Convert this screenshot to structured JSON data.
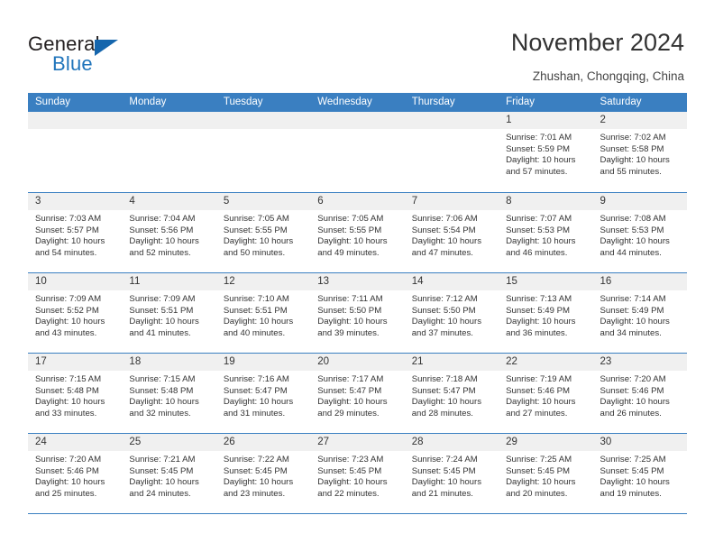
{
  "brand": {
    "name_part1": "General",
    "name_part2": "Blue",
    "accent_color": "#1f74bb"
  },
  "header": {
    "title": "November 2024",
    "subtitle": "Zhushan, Chongqing, China"
  },
  "calendar": {
    "header_bg": "#3a7fc1",
    "weekdays": [
      "Sunday",
      "Monday",
      "Tuesday",
      "Wednesday",
      "Thursday",
      "Friday",
      "Saturday"
    ],
    "weeks": [
      [
        {
          "day": "",
          "sunrise": "",
          "sunset": "",
          "daylight": "",
          "empty": true
        },
        {
          "day": "",
          "sunrise": "",
          "sunset": "",
          "daylight": "",
          "empty": true
        },
        {
          "day": "",
          "sunrise": "",
          "sunset": "",
          "daylight": "",
          "empty": true
        },
        {
          "day": "",
          "sunrise": "",
          "sunset": "",
          "daylight": "",
          "empty": true
        },
        {
          "day": "",
          "sunrise": "",
          "sunset": "",
          "daylight": "",
          "empty": true
        },
        {
          "day": "1",
          "sunrise": "Sunrise: 7:01 AM",
          "sunset": "Sunset: 5:59 PM",
          "daylight": "Daylight: 10 hours and 57 minutes.",
          "empty": false
        },
        {
          "day": "2",
          "sunrise": "Sunrise: 7:02 AM",
          "sunset": "Sunset: 5:58 PM",
          "daylight": "Daylight: 10 hours and 55 minutes.",
          "empty": false
        }
      ],
      [
        {
          "day": "3",
          "sunrise": "Sunrise: 7:03 AM",
          "sunset": "Sunset: 5:57 PM",
          "daylight": "Daylight: 10 hours and 54 minutes.",
          "empty": false
        },
        {
          "day": "4",
          "sunrise": "Sunrise: 7:04 AM",
          "sunset": "Sunset: 5:56 PM",
          "daylight": "Daylight: 10 hours and 52 minutes.",
          "empty": false
        },
        {
          "day": "5",
          "sunrise": "Sunrise: 7:05 AM",
          "sunset": "Sunset: 5:55 PM",
          "daylight": "Daylight: 10 hours and 50 minutes.",
          "empty": false
        },
        {
          "day": "6",
          "sunrise": "Sunrise: 7:05 AM",
          "sunset": "Sunset: 5:55 PM",
          "daylight": "Daylight: 10 hours and 49 minutes.",
          "empty": false
        },
        {
          "day": "7",
          "sunrise": "Sunrise: 7:06 AM",
          "sunset": "Sunset: 5:54 PM",
          "daylight": "Daylight: 10 hours and 47 minutes.",
          "empty": false
        },
        {
          "day": "8",
          "sunrise": "Sunrise: 7:07 AM",
          "sunset": "Sunset: 5:53 PM",
          "daylight": "Daylight: 10 hours and 46 minutes.",
          "empty": false
        },
        {
          "day": "9",
          "sunrise": "Sunrise: 7:08 AM",
          "sunset": "Sunset: 5:53 PM",
          "daylight": "Daylight: 10 hours and 44 minutes.",
          "empty": false
        }
      ],
      [
        {
          "day": "10",
          "sunrise": "Sunrise: 7:09 AM",
          "sunset": "Sunset: 5:52 PM",
          "daylight": "Daylight: 10 hours and 43 minutes.",
          "empty": false
        },
        {
          "day": "11",
          "sunrise": "Sunrise: 7:09 AM",
          "sunset": "Sunset: 5:51 PM",
          "daylight": "Daylight: 10 hours and 41 minutes.",
          "empty": false
        },
        {
          "day": "12",
          "sunrise": "Sunrise: 7:10 AM",
          "sunset": "Sunset: 5:51 PM",
          "daylight": "Daylight: 10 hours and 40 minutes.",
          "empty": false
        },
        {
          "day": "13",
          "sunrise": "Sunrise: 7:11 AM",
          "sunset": "Sunset: 5:50 PM",
          "daylight": "Daylight: 10 hours and 39 minutes.",
          "empty": false
        },
        {
          "day": "14",
          "sunrise": "Sunrise: 7:12 AM",
          "sunset": "Sunset: 5:50 PM",
          "daylight": "Daylight: 10 hours and 37 minutes.",
          "empty": false
        },
        {
          "day": "15",
          "sunrise": "Sunrise: 7:13 AM",
          "sunset": "Sunset: 5:49 PM",
          "daylight": "Daylight: 10 hours and 36 minutes.",
          "empty": false
        },
        {
          "day": "16",
          "sunrise": "Sunrise: 7:14 AM",
          "sunset": "Sunset: 5:49 PM",
          "daylight": "Daylight: 10 hours and 34 minutes.",
          "empty": false
        }
      ],
      [
        {
          "day": "17",
          "sunrise": "Sunrise: 7:15 AM",
          "sunset": "Sunset: 5:48 PM",
          "daylight": "Daylight: 10 hours and 33 minutes.",
          "empty": false
        },
        {
          "day": "18",
          "sunrise": "Sunrise: 7:15 AM",
          "sunset": "Sunset: 5:48 PM",
          "daylight": "Daylight: 10 hours and 32 minutes.",
          "empty": false
        },
        {
          "day": "19",
          "sunrise": "Sunrise: 7:16 AM",
          "sunset": "Sunset: 5:47 PM",
          "daylight": "Daylight: 10 hours and 31 minutes.",
          "empty": false
        },
        {
          "day": "20",
          "sunrise": "Sunrise: 7:17 AM",
          "sunset": "Sunset: 5:47 PM",
          "daylight": "Daylight: 10 hours and 29 minutes.",
          "empty": false
        },
        {
          "day": "21",
          "sunrise": "Sunrise: 7:18 AM",
          "sunset": "Sunset: 5:47 PM",
          "daylight": "Daylight: 10 hours and 28 minutes.",
          "empty": false
        },
        {
          "day": "22",
          "sunrise": "Sunrise: 7:19 AM",
          "sunset": "Sunset: 5:46 PM",
          "daylight": "Daylight: 10 hours and 27 minutes.",
          "empty": false
        },
        {
          "day": "23",
          "sunrise": "Sunrise: 7:20 AM",
          "sunset": "Sunset: 5:46 PM",
          "daylight": "Daylight: 10 hours and 26 minutes.",
          "empty": false
        }
      ],
      [
        {
          "day": "24",
          "sunrise": "Sunrise: 7:20 AM",
          "sunset": "Sunset: 5:46 PM",
          "daylight": "Daylight: 10 hours and 25 minutes.",
          "empty": false
        },
        {
          "day": "25",
          "sunrise": "Sunrise: 7:21 AM",
          "sunset": "Sunset: 5:45 PM",
          "daylight": "Daylight: 10 hours and 24 minutes.",
          "empty": false
        },
        {
          "day": "26",
          "sunrise": "Sunrise: 7:22 AM",
          "sunset": "Sunset: 5:45 PM",
          "daylight": "Daylight: 10 hours and 23 minutes.",
          "empty": false
        },
        {
          "day": "27",
          "sunrise": "Sunrise: 7:23 AM",
          "sunset": "Sunset: 5:45 PM",
          "daylight": "Daylight: 10 hours and 22 minutes.",
          "empty": false
        },
        {
          "day": "28",
          "sunrise": "Sunrise: 7:24 AM",
          "sunset": "Sunset: 5:45 PM",
          "daylight": "Daylight: 10 hours and 21 minutes.",
          "empty": false
        },
        {
          "day": "29",
          "sunrise": "Sunrise: 7:25 AM",
          "sunset": "Sunset: 5:45 PM",
          "daylight": "Daylight: 10 hours and 20 minutes.",
          "empty": false
        },
        {
          "day": "30",
          "sunrise": "Sunrise: 7:25 AM",
          "sunset": "Sunset: 5:45 PM",
          "daylight": "Daylight: 10 hours and 19 minutes.",
          "empty": false
        }
      ]
    ]
  }
}
